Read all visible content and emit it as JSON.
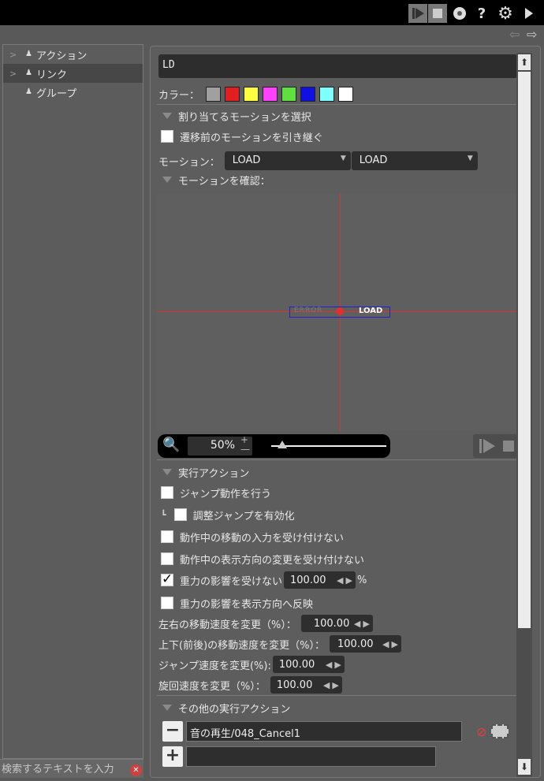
{
  "topbar": {
    "icons": [
      "play-icon",
      "stop-icon",
      "record-icon",
      "help-icon",
      "gear-icon",
      "forward-icon"
    ],
    "help_label": "?"
  },
  "subbar": {
    "back_arrow": "⇦",
    "fwd_arrow": "⇨"
  },
  "sidebar": {
    "items": [
      {
        "label": "アクション",
        "icon": "person-icon"
      },
      {
        "label": "リンク",
        "icon": "person-icon"
      },
      {
        "label": "グループ",
        "icon": "person-icon"
      }
    ],
    "search_placeholder": "検索するテキストを入力"
  },
  "editor": {
    "name": "LD",
    "color_label": "カラー：",
    "colors": [
      "#a0a0a0",
      "#e02020",
      "#ffff40",
      "#ff40ff",
      "#60e040",
      "#1010e0",
      "#80ffff",
      "#ffffff"
    ],
    "section_assign": "割り当てるモーションを選択",
    "inherit_label": "遷移前のモーションを引き継ぐ",
    "motion_label": "モーション：",
    "motion_1": "LOAD",
    "motion_2": "LOAD",
    "section_confirm": "モーションを確認：",
    "preview_left_text": "ERROR",
    "preview_right_text": "LOAD",
    "zoom_value": "50%",
    "section_exec": "実行アクション",
    "jump_label": "ジャンプ動作を行う",
    "adjust_jump_label": "調整ジャンプを有効化",
    "corner_glyph": "┗",
    "no_move_label": "動作中の移動の入力を受け付けない",
    "no_dir_label": "動作中の表示方向の変更を受け付けない",
    "gravity_label": "重力の影響を受けない",
    "gravity_value": "100.00",
    "percent": "%",
    "gravity_dir_label": "重力の影響を表示方向へ反映",
    "lr_speed_label": "左右の移動速度を変更（%）：",
    "lr_speed_value": "100.00",
    "ud_speed_label": "上下(前後)の移動速度を変更（%）：",
    "ud_speed_value": "100.00",
    "jump_speed_label": "ジャンプ速度を変更(%):",
    "jump_speed_value": "100.00",
    "turn_speed_label": "旋回速度を変更（%）：",
    "turn_speed_value": "100.00",
    "section_other": "その他の実行アクション",
    "other_action_1": "音の再生/048_Cancel1",
    "other_action_2": ""
  }
}
